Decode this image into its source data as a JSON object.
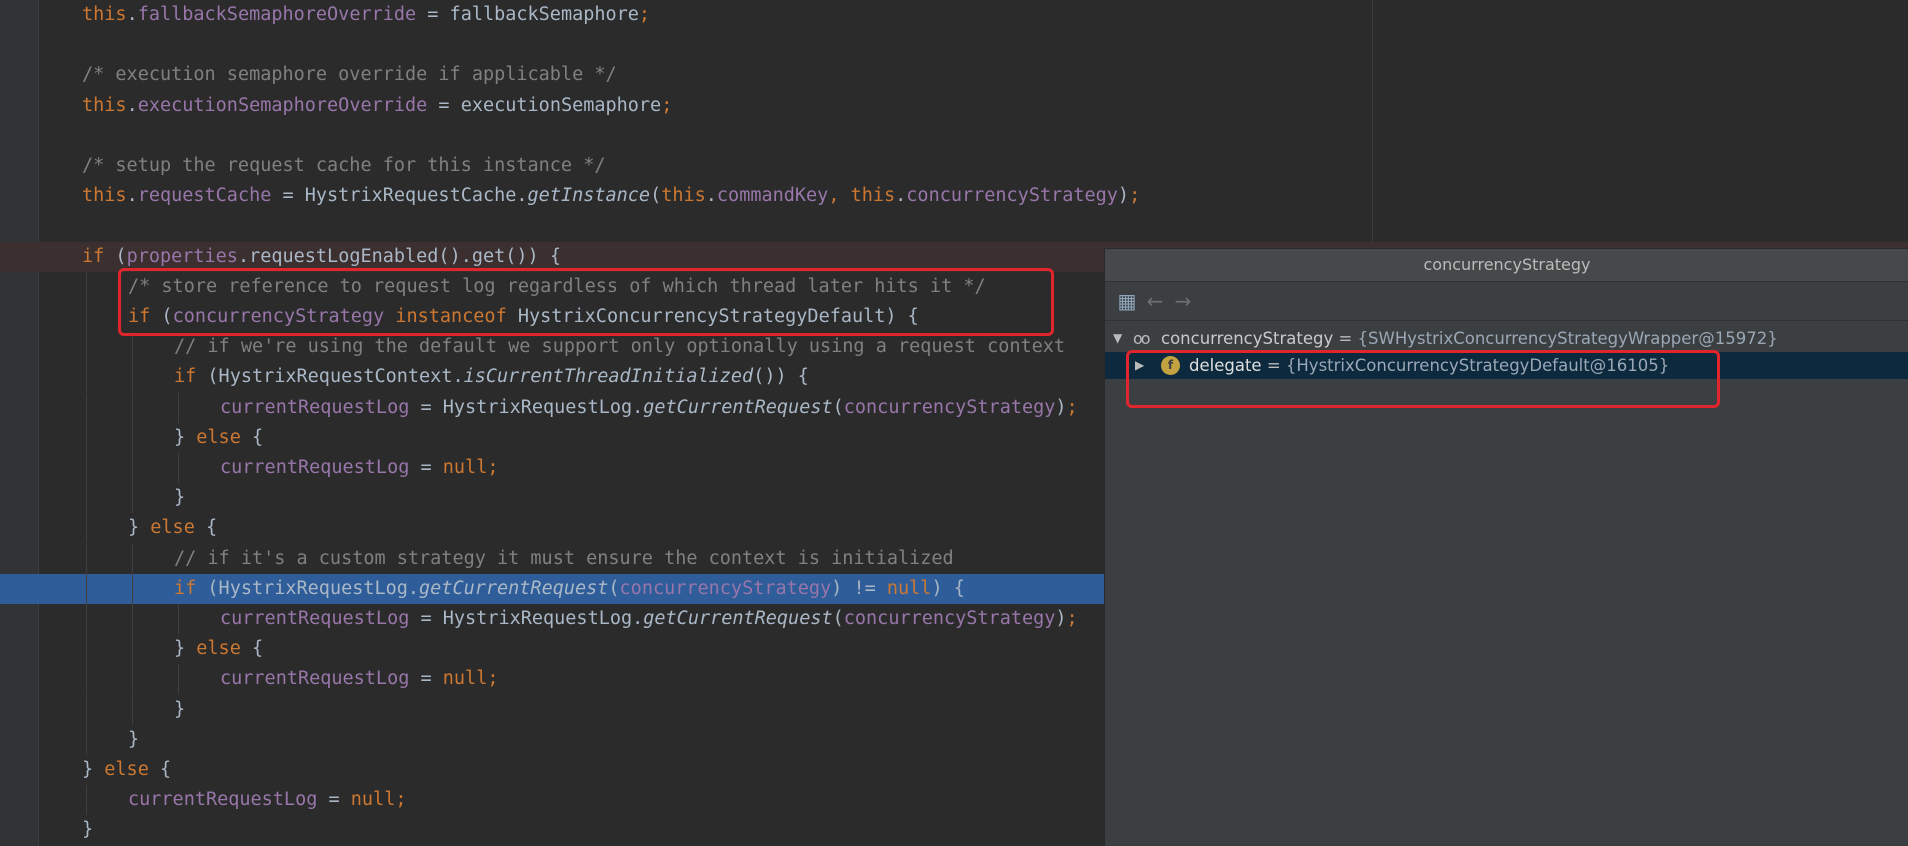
{
  "lines": [
    {
      "indent": 0,
      "segments": [
        {
          "t": "this",
          "c": "kw"
        },
        {
          "t": ".",
          "c": "plain"
        },
        {
          "t": "fallbackSemaphoreOverride",
          "c": "fld"
        },
        {
          "t": " = fallbackSemaphore",
          "c": "plain"
        },
        {
          "t": ";",
          "c": "kw"
        }
      ]
    },
    {
      "indent": 0,
      "segments": []
    },
    {
      "indent": 0,
      "segments": [
        {
          "t": "/* execution semaphore override if applicable */",
          "c": "cmt"
        }
      ]
    },
    {
      "indent": 0,
      "segments": [
        {
          "t": "this",
          "c": "kw"
        },
        {
          "t": ".",
          "c": "plain"
        },
        {
          "t": "executionSemaphoreOverride",
          "c": "fld"
        },
        {
          "t": " = executionSemaphore",
          "c": "plain"
        },
        {
          "t": ";",
          "c": "kw"
        }
      ]
    },
    {
      "indent": 0,
      "segments": []
    },
    {
      "indent": 0,
      "segments": [
        {
          "t": "/* setup the request cache for this instance */",
          "c": "cmt"
        }
      ]
    },
    {
      "indent": 0,
      "segments": [
        {
          "t": "this",
          "c": "kw"
        },
        {
          "t": ".",
          "c": "plain"
        },
        {
          "t": "requestCache",
          "c": "fld"
        },
        {
          "t": " = HystrixRequestCache.",
          "c": "plain"
        },
        {
          "t": "getInstance",
          "c": "plain ital"
        },
        {
          "t": "(",
          "c": "plain"
        },
        {
          "t": "this",
          "c": "kw"
        },
        {
          "t": ".",
          "c": "plain"
        },
        {
          "t": "commandKey",
          "c": "fld"
        },
        {
          "t": ", ",
          "c": "kw"
        },
        {
          "t": "this",
          "c": "kw"
        },
        {
          "t": ".",
          "c": "plain"
        },
        {
          "t": "concurrencyStrategy",
          "c": "fld"
        },
        {
          "t": ")",
          "c": "plain"
        },
        {
          "t": ";",
          "c": "kw"
        }
      ]
    },
    {
      "indent": 0,
      "segments": []
    },
    {
      "indent": 0,
      "segments": [
        {
          "t": "if ",
          "c": "kw"
        },
        {
          "t": "(",
          "c": "plain"
        },
        {
          "t": "properties",
          "c": "fld"
        },
        {
          "t": ".requestLogEnabled().get()) {",
          "c": "plain"
        }
      ]
    },
    {
      "indent": 1,
      "segments": [
        {
          "t": "/* store reference to request log regardless of which thread later hits it */",
          "c": "cmt"
        }
      ]
    },
    {
      "indent": 1,
      "segments": [
        {
          "t": "if ",
          "c": "kw"
        },
        {
          "t": "(",
          "c": "plain"
        },
        {
          "t": "concurrencyStrategy",
          "c": "fld"
        },
        {
          "t": " instanceof ",
          "c": "kw"
        },
        {
          "t": "HystrixConcurrencyStrategyDefault) {",
          "c": "plain"
        }
      ]
    },
    {
      "indent": 2,
      "segments": [
        {
          "t": "// if we're using the default we support only optionally using a request context",
          "c": "cmt"
        }
      ]
    },
    {
      "indent": 2,
      "segments": [
        {
          "t": "if ",
          "c": "kw"
        },
        {
          "t": "(HystrixRequestContext.",
          "c": "plain"
        },
        {
          "t": "isCurrentThreadInitialized",
          "c": "plain ital"
        },
        {
          "t": "()) {",
          "c": "plain"
        }
      ]
    },
    {
      "indent": 3,
      "segments": [
        {
          "t": "currentRequestLog",
          "c": "fld"
        },
        {
          "t": " = HystrixRequestLog.",
          "c": "plain"
        },
        {
          "t": "getCurrentRequest",
          "c": "plain ital"
        },
        {
          "t": "(",
          "c": "plain"
        },
        {
          "t": "concurrencyStrategy",
          "c": "fld"
        },
        {
          "t": ")",
          "c": "plain"
        },
        {
          "t": ";",
          "c": "kw"
        }
      ]
    },
    {
      "indent": 2,
      "segments": [
        {
          "t": "} ",
          "c": "plain"
        },
        {
          "t": "else ",
          "c": "kw"
        },
        {
          "t": "{",
          "c": "plain"
        }
      ]
    },
    {
      "indent": 3,
      "segments": [
        {
          "t": "currentRequestLog",
          "c": "fld"
        },
        {
          "t": " = ",
          "c": "plain"
        },
        {
          "t": "null",
          "c": "kw"
        },
        {
          "t": ";",
          "c": "kw"
        }
      ]
    },
    {
      "indent": 2,
      "segments": [
        {
          "t": "}",
          "c": "plain"
        }
      ]
    },
    {
      "indent": 1,
      "segments": [
        {
          "t": "} ",
          "c": "plain"
        },
        {
          "t": "else ",
          "c": "kw"
        },
        {
          "t": "{",
          "c": "plain"
        }
      ]
    },
    {
      "indent": 2,
      "segments": [
        {
          "t": "// if it's a custom strategy it must ensure the context is initialized",
          "c": "cmt"
        }
      ]
    },
    {
      "indent": 2,
      "segments": [
        {
          "t": "if ",
          "c": "kw"
        },
        {
          "t": "(HystrixRequestLog.",
          "c": "plain"
        },
        {
          "t": "getCurrentRequest",
          "c": "plain ital"
        },
        {
          "t": "(",
          "c": "plain"
        },
        {
          "t": "concurrencyStrategy",
          "c": "fld"
        },
        {
          "t": ") != ",
          "c": "plain"
        },
        {
          "t": "null",
          "c": "kw"
        },
        {
          "t": ") {",
          "c": "plain"
        }
      ]
    },
    {
      "indent": 3,
      "segments": [
        {
          "t": "currentRequestLog",
          "c": "fld"
        },
        {
          "t": " = HystrixRequestLog.",
          "c": "plain"
        },
        {
          "t": "getCurrentRequest",
          "c": "plain ital"
        },
        {
          "t": "(",
          "c": "plain"
        },
        {
          "t": "concurrencyStrategy",
          "c": "fld"
        },
        {
          "t": ")",
          "c": "plain"
        },
        {
          "t": ";",
          "c": "kw"
        }
      ]
    },
    {
      "indent": 2,
      "segments": [
        {
          "t": "} ",
          "c": "plain"
        },
        {
          "t": "else ",
          "c": "kw"
        },
        {
          "t": "{",
          "c": "plain"
        }
      ]
    },
    {
      "indent": 3,
      "segments": [
        {
          "t": "currentRequestLog",
          "c": "fld"
        },
        {
          "t": " = ",
          "c": "plain"
        },
        {
          "t": "null",
          "c": "kw"
        },
        {
          "t": ";",
          "c": "kw"
        }
      ]
    },
    {
      "indent": 2,
      "segments": [
        {
          "t": "}",
          "c": "plain"
        }
      ]
    },
    {
      "indent": 1,
      "segments": [
        {
          "t": "}",
          "c": "plain"
        }
      ]
    },
    {
      "indent": 0,
      "segments": [
        {
          "t": "} ",
          "c": "plain"
        },
        {
          "t": "else ",
          "c": "kw"
        },
        {
          "t": "{",
          "c": "plain"
        }
      ]
    },
    {
      "indent": 1,
      "segments": [
        {
          "t": "currentRequestLog",
          "c": "fld"
        },
        {
          "t": " = ",
          "c": "plain"
        },
        {
          "t": "null",
          "c": "kw"
        },
        {
          "t": ";",
          "c": "kw"
        }
      ]
    },
    {
      "indent": 0,
      "segments": [
        {
          "t": "}",
          "c": "plain"
        }
      ]
    }
  ],
  "breakpoint_line": 8,
  "current_line": 19,
  "colors": {
    "keyword": "#cc7832",
    "field": "#9876aa",
    "comment": "#808080",
    "text": "#a9b7c6",
    "current_line_bg": "#2e5d99",
    "annotation_red": "#e0262c"
  },
  "popup": {
    "title": "concurrencyStrategy",
    "toolbar": {
      "tree_icon": "tree-view-icon",
      "back_icon": "back-arrow-icon",
      "forward_icon": "forward-arrow-icon"
    },
    "root": {
      "icon": "watch-glasses-icon",
      "name": "concurrencyStrategy",
      "eq": " = ",
      "value": "{SWHystrixConcurrencyStrategyWrapper@15972}"
    },
    "child": {
      "icon": "field-icon",
      "icon_glyph": "f",
      "name": "delegate",
      "eq": " = ",
      "value": "{HystrixConcurrencyStrategyDefault@16105}"
    }
  }
}
